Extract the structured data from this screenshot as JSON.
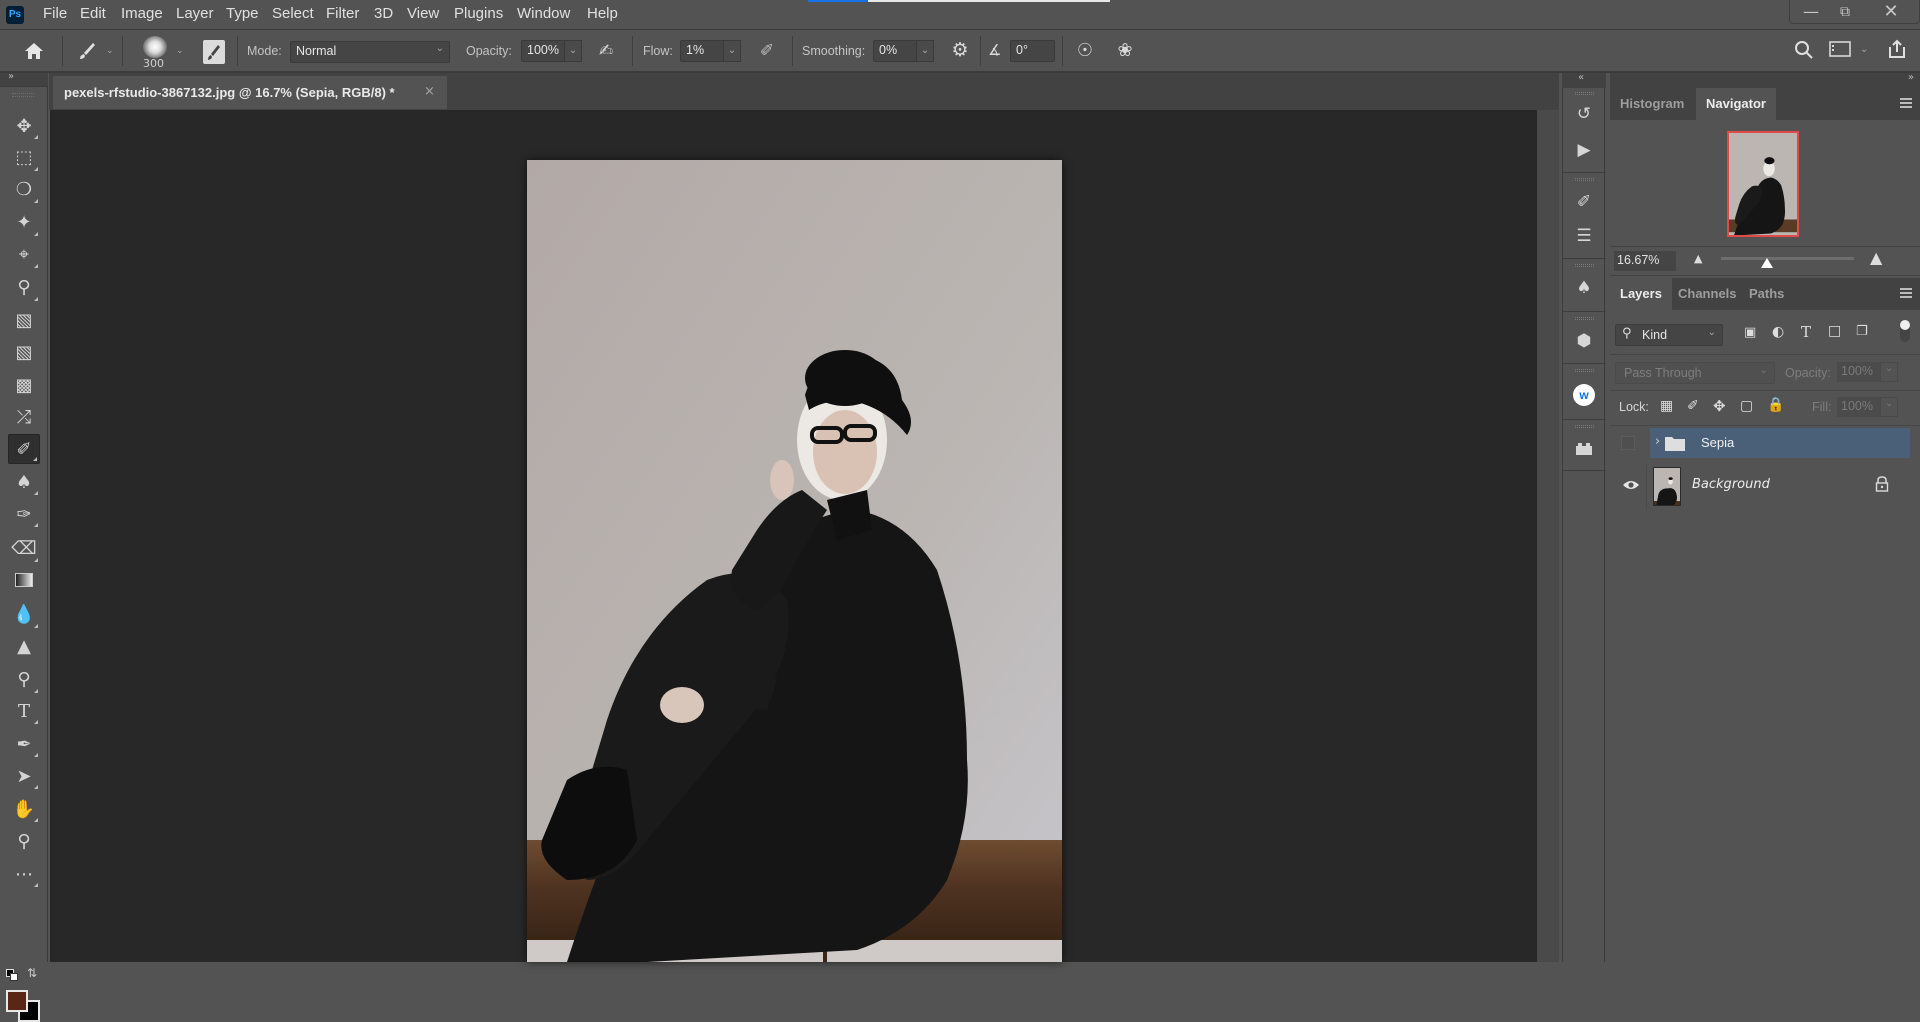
{
  "app": {
    "logo": "Ps",
    "name": "Adobe Photoshop"
  },
  "menu": [
    "File",
    "Edit",
    "Image",
    "Layer",
    "Type",
    "Select",
    "Filter",
    "3D",
    "View",
    "Plugins",
    "Window",
    "Help"
  ],
  "progress": {
    "fraction": 0.2
  },
  "window_controls": {
    "minimize": "minimize-icon",
    "restore": "restore-icon",
    "close": "close-icon"
  },
  "options_bar": {
    "brush_size": "300",
    "mode_label": "Mode:",
    "mode_value": "Normal",
    "opacity_label": "Opacity:",
    "opacity_value": "100%",
    "flow_label": "Flow:",
    "flow_value": "1%",
    "smoothing_label": "Smoothing:",
    "smoothing_value": "0%",
    "angle_value": "0°"
  },
  "document_tab": {
    "title": "pexels-rfstudio-3867132.jpg @ 16.7% (Sepia, RGB/8) *",
    "close": "×"
  },
  "colors": {
    "foreground": "#5a2616",
    "background": "#000000",
    "selection": "#4a6079",
    "nav_frame": "#e24a4a",
    "progress": "#1473e6"
  },
  "navigator": {
    "tabs": [
      "Histogram",
      "Navigator"
    ],
    "active_tab": "Navigator",
    "zoom_value": "16.67%"
  },
  "layers": {
    "tabs": [
      "Layers",
      "Channels",
      "Paths"
    ],
    "active_tab": "Layers",
    "filter_kind": "Kind",
    "blend_mode": "Pass Through",
    "opacity_label": "Opacity:",
    "opacity_value": "100%",
    "lock_label": "Lock:",
    "fill_label": "Fill:",
    "fill_value": "100%",
    "items": [
      {
        "name": "Sepia",
        "type": "group",
        "visible": false,
        "selected": true
      },
      {
        "name": "Background",
        "type": "image",
        "visible": true,
        "locked": true
      }
    ]
  },
  "tools": [
    "move",
    "rectangular-marquee",
    "lasso",
    "magic-wand",
    "crop",
    "eyedropper",
    "spot-healing-brush",
    "healing-brush",
    "patch",
    "content-aware-move",
    "brush",
    "clone-stamp",
    "history-brush",
    "eraser",
    "gradient",
    "blur",
    "sharpen",
    "dodge",
    "type",
    "pen",
    "path-selection",
    "hand",
    "zoom",
    "more"
  ],
  "active_tool": "brush"
}
